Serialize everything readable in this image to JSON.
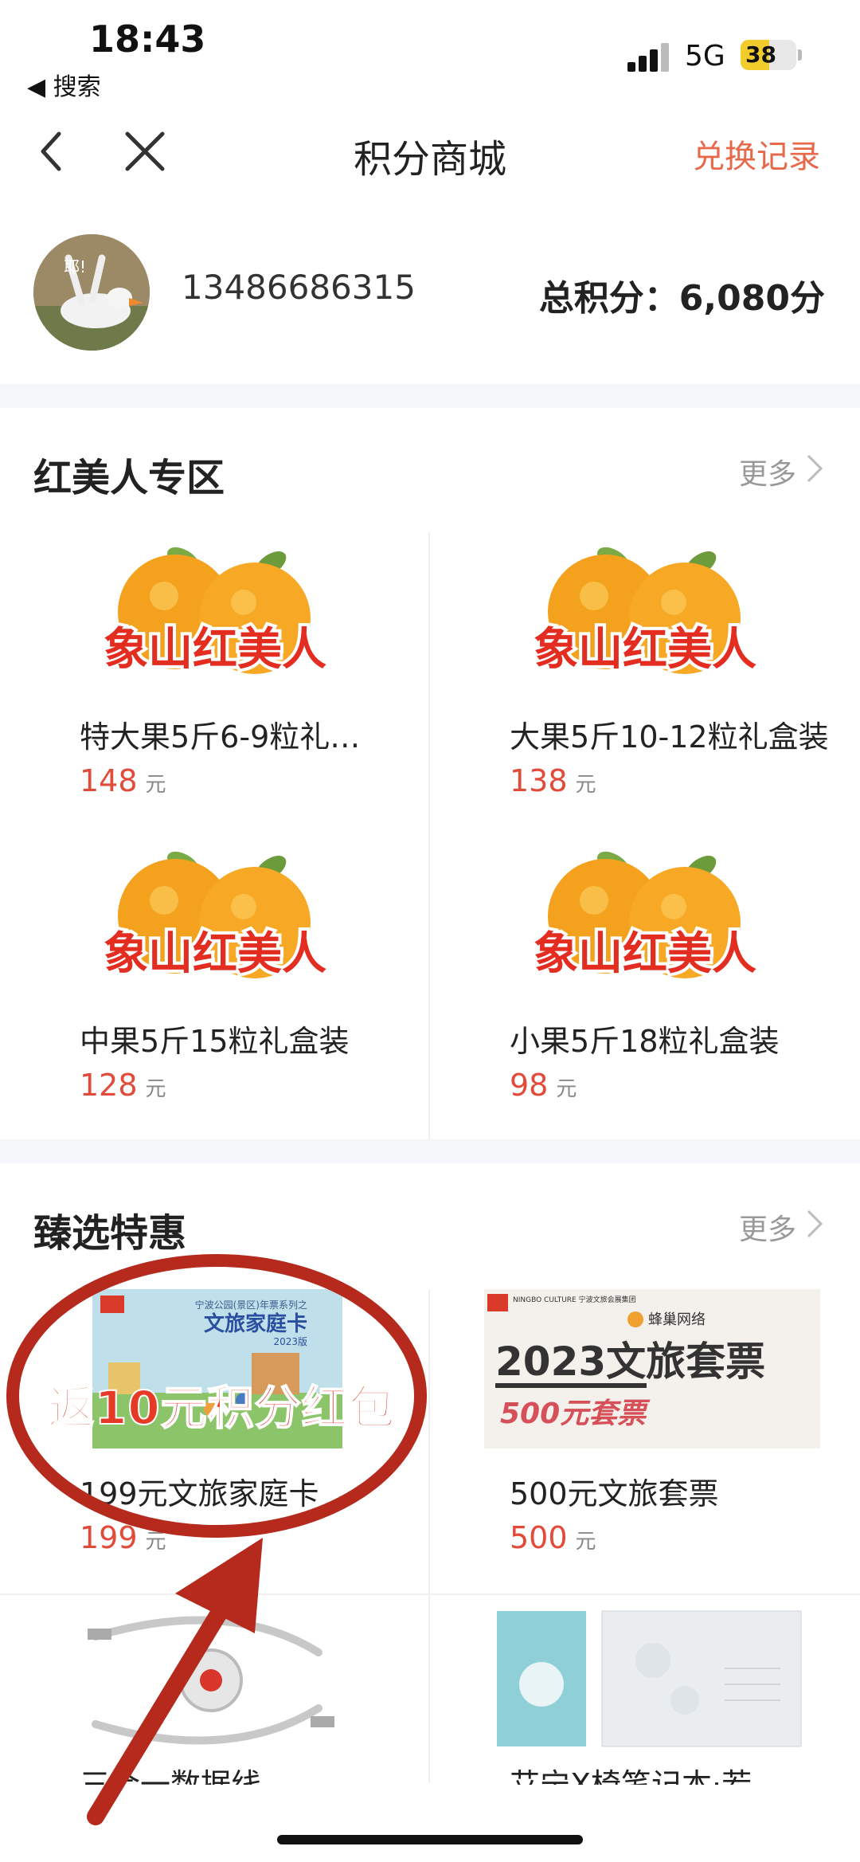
{
  "status_bar": {
    "time": "18:43",
    "back_app": "◀ 搜索",
    "network": "5G",
    "battery": "38"
  },
  "nav": {
    "title": "积分商城",
    "record_link": "兑换记录"
  },
  "profile": {
    "avatar_caption": "耶!",
    "phone": "13486686315",
    "points": "总积分：6,080分"
  },
  "section1": {
    "title": "红美人专区",
    "more": "更多",
    "banner_text": "象山红美人",
    "unit": "元",
    "products": [
      {
        "name": "特大果5斤6-9粒礼…",
        "price": "148"
      },
      {
        "name": "大果5斤10-12粒礼盒装",
        "price": "138"
      },
      {
        "name": "中果5斤15粒礼盒装",
        "price": "128"
      },
      {
        "name": "小果5斤18粒礼盒装",
        "price": "98"
      }
    ]
  },
  "section2": {
    "title": "臻选特惠",
    "more": "更多",
    "unit": "元",
    "promo_overlay": "返10元积分红包",
    "card1_top": "宁波公园(景区)年票系列之",
    "card1_banner": "文旅家庭卡",
    "card1_year": "2023版",
    "card2_org": "NINGBO CULTURE 宁波文旅会展集团",
    "card2_brand": "蜂巢网络",
    "card2_title": "2023文旅套票",
    "card2_sub": "500元套票",
    "products": [
      {
        "name": "199元文旅家庭卡",
        "price": "199"
      },
      {
        "name": "500元文旅套票",
        "price": "500"
      },
      {
        "name": "三合一数据线",
        "price": ""
      },
      {
        "name": "艾宁X椅笔记本·若",
        "price": ""
      }
    ]
  },
  "colors": {
    "accent": "#e8694a",
    "price": "#e24a3a",
    "annotation": "#b52a1c"
  }
}
